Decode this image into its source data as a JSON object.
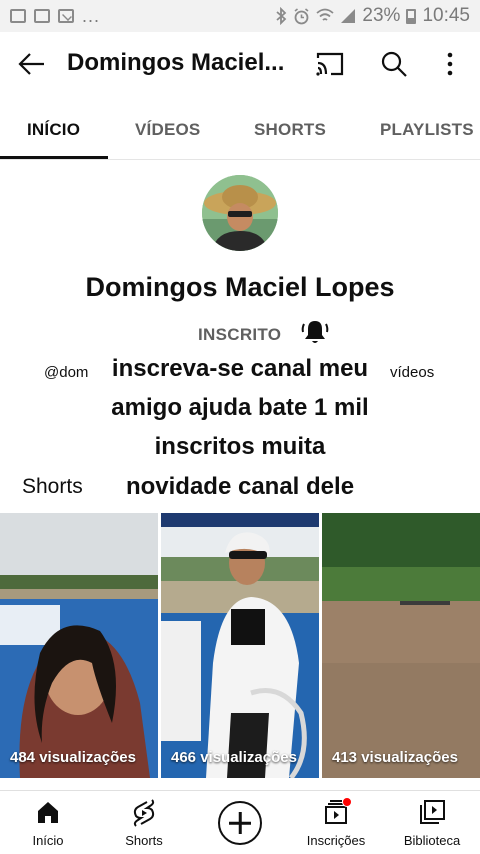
{
  "status_bar": {
    "dots": "...",
    "battery_percent": "23%",
    "time": "10:45"
  },
  "app_bar": {
    "title": "Domingos Maciel..."
  },
  "tabs": [
    {
      "label": "INÍCIO",
      "active": true
    },
    {
      "label": "VÍDEOS",
      "active": false
    },
    {
      "label": "SHORTS",
      "active": false
    },
    {
      "label": "PLAYLISTS",
      "active": false
    }
  ],
  "channel": {
    "name": "Domingos Maciel Lopes",
    "subscribed_label": "INSCRITO",
    "handle": "@dom",
    "videos_label": "vídeos",
    "description_lines": [
      "inscreva-se canal meu",
      "amigo ajuda bate 1 mil",
      "inscritos muita",
      "novidade canal dele"
    ]
  },
  "shorts_section": {
    "heading": "Shorts",
    "items": [
      {
        "views": "484 visualizações"
      },
      {
        "views": "466 visualizações"
      },
      {
        "views": "413 visualizações"
      }
    ]
  },
  "bottom_nav": [
    {
      "label": "Início",
      "icon": "home-icon"
    },
    {
      "label": "Shorts",
      "icon": "shorts-icon"
    },
    {
      "label": "",
      "icon": "create-icon"
    },
    {
      "label": "Inscrições",
      "icon": "subscriptions-icon"
    },
    {
      "label": "Biblioteca",
      "icon": "library-icon"
    }
  ],
  "colors": {
    "notification_dot": "#ff0000",
    "text_primary": "#0f0f0f",
    "text_secondary": "#606060"
  }
}
